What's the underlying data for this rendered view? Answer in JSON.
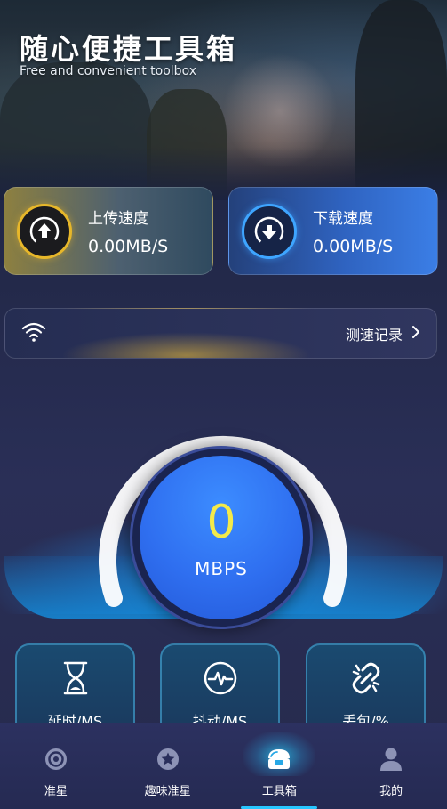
{
  "hero": {
    "title": "随心便捷工具箱",
    "subtitle": "Free and convenient toolbox"
  },
  "speed_cards": {
    "upload": {
      "label": "上传速度",
      "value": "0.00MB/S",
      "icon": "upload-icon",
      "accent": "#e7b72a"
    },
    "download": {
      "label": "下载速度",
      "value": "0.00MB/S",
      "icon": "download-icon",
      "accent": "#3ea5ff"
    }
  },
  "record_bar": {
    "icon": "wifi-icon",
    "link_label": "测速记录"
  },
  "gauge": {
    "value": "0",
    "unit": "MBPS",
    "value_color": "#f3ea4a"
  },
  "metrics": [
    {
      "label": "延时/MS",
      "icon": "hourglass-icon"
    },
    {
      "label": "抖动/MS",
      "icon": "pulse-icon"
    },
    {
      "label": "丢包/%",
      "icon": "broken-link-icon"
    }
  ],
  "bottom_nav": [
    {
      "label": "准星",
      "icon": "crosshair-icon",
      "active": false
    },
    {
      "label": "趣味准星",
      "icon": "star-icon",
      "active": false
    },
    {
      "label": "工具箱",
      "icon": "toolbox-icon",
      "active": true
    },
    {
      "label": "我的",
      "icon": "user-icon",
      "active": false
    }
  ]
}
